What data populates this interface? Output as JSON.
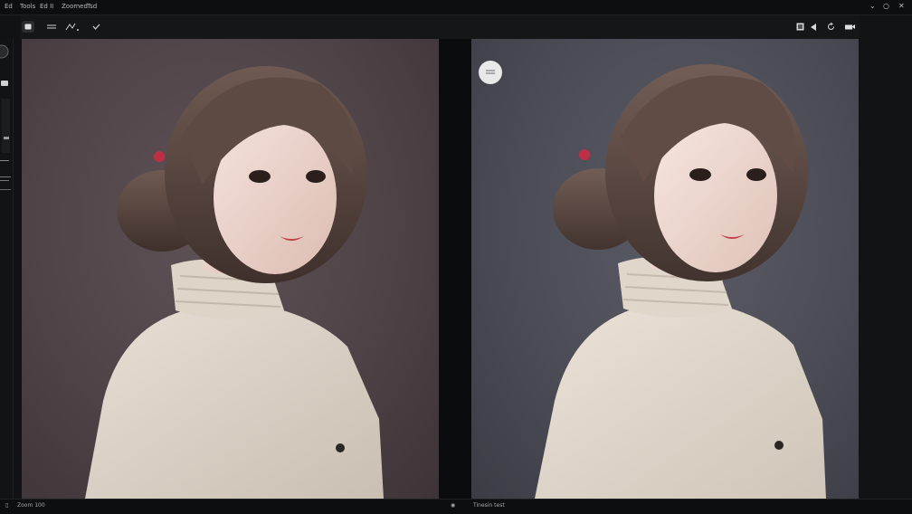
{
  "menu": {
    "items": [
      "Ed",
      "Tools",
      "Ed II",
      "Zoomed",
      "Tsd"
    ]
  },
  "window_controls": {
    "minimize": "⌄",
    "restore": "○",
    "close": "✕"
  },
  "toolbar": {
    "left_icons": [
      "panel-icon",
      "list-icon",
      "curve-icon",
      "check-icon"
    ],
    "right_icons": [
      "image-icon",
      "play-icon",
      "rotate-icon",
      "camera-icon"
    ]
  },
  "status": {
    "left_text": "Zoom 100",
    "mid_text": "Tinesin test"
  },
  "colors": {
    "left_background": "#4e4347",
    "right_background": "#4b4c55",
    "ui_dark": "#111214"
  }
}
